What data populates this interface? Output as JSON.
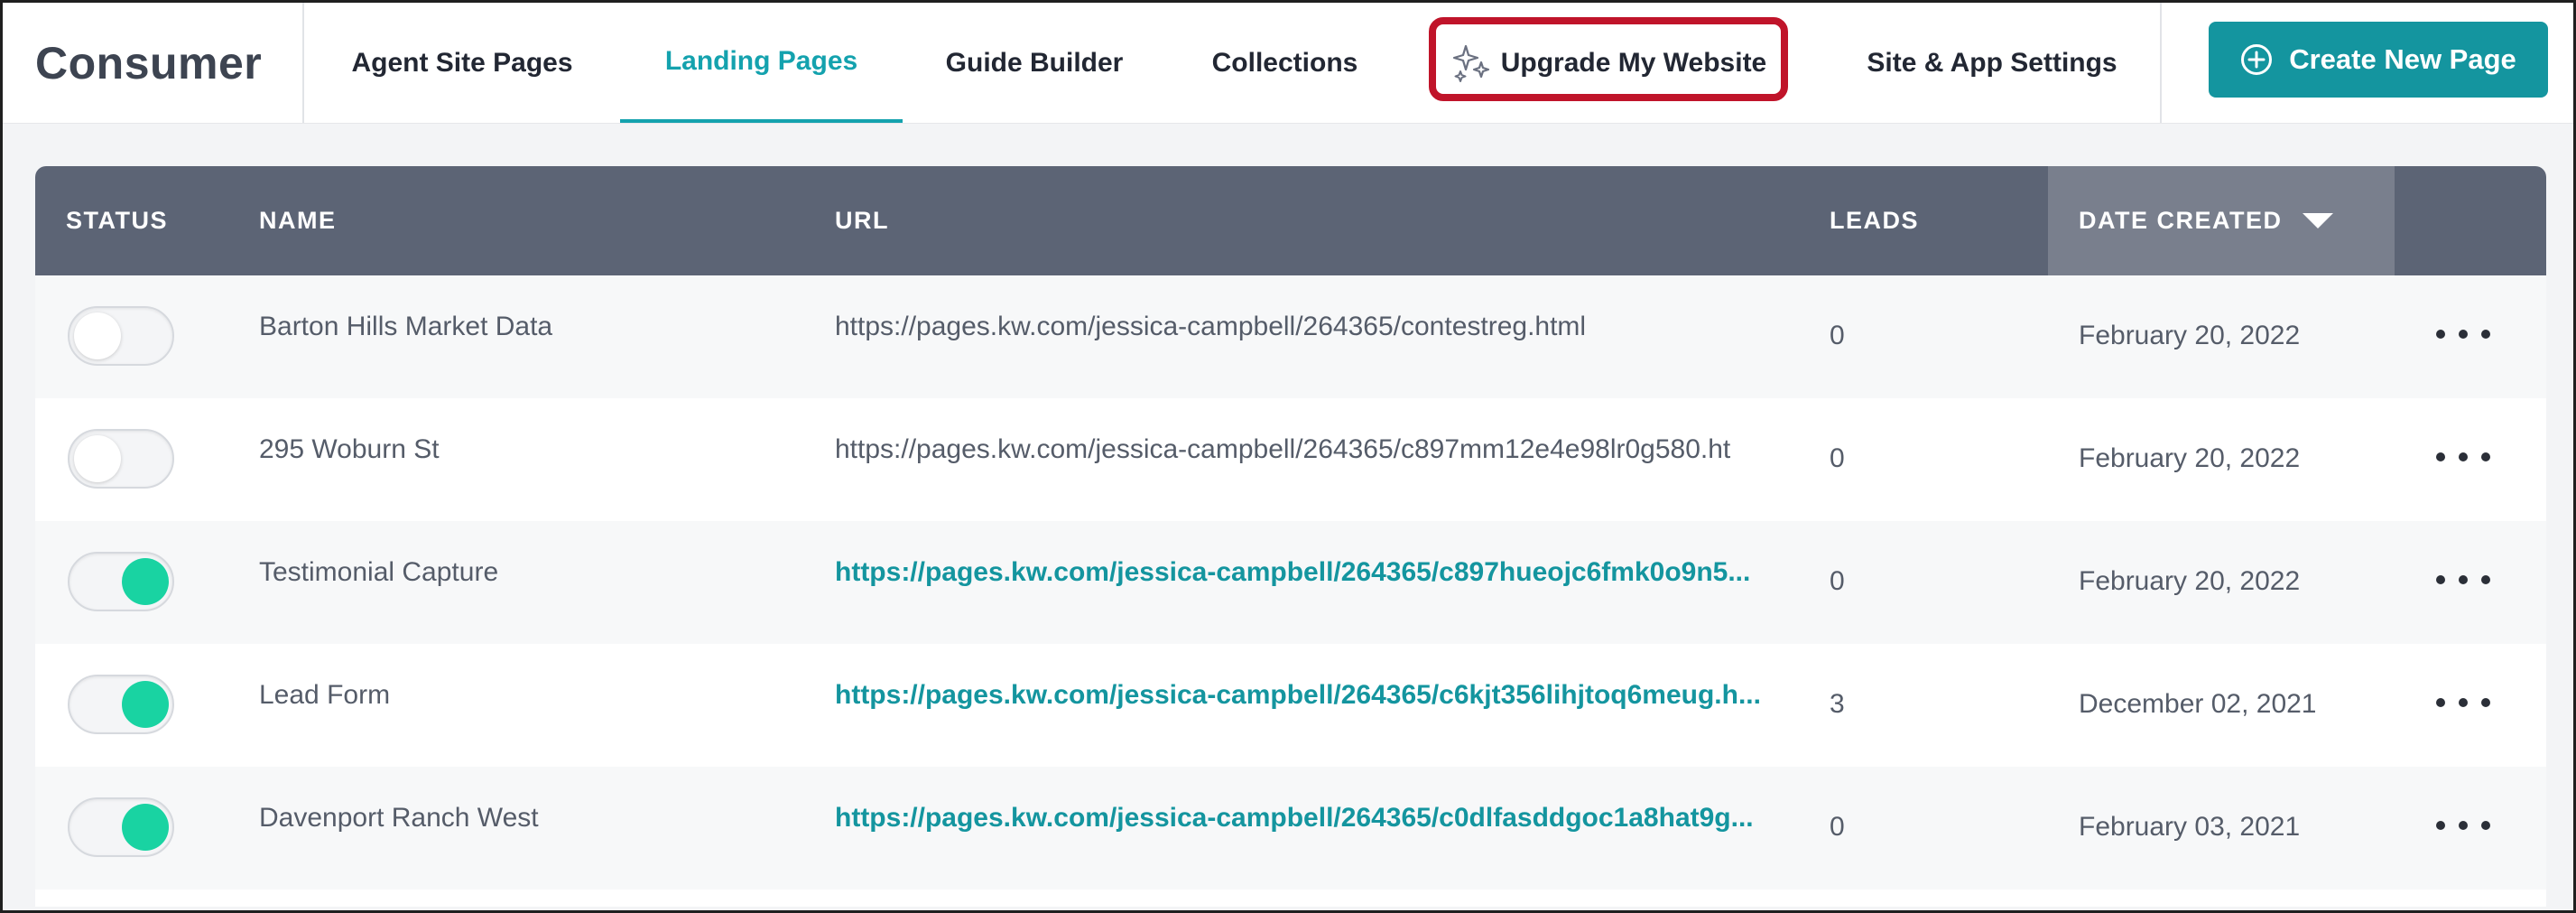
{
  "brand": "Consumer",
  "tabs": [
    {
      "label": "Agent Site Pages"
    },
    {
      "label": "Landing Pages"
    },
    {
      "label": "Guide Builder"
    },
    {
      "label": "Collections"
    },
    {
      "label": "Upgrade My Website",
      "icon": "sparkles-icon"
    },
    {
      "label": "Site & App Settings"
    }
  ],
  "active_tab": "Landing Pages",
  "create_button": {
    "label": "Create New Page",
    "icon": "plus-circle-icon"
  },
  "colors": {
    "accent": "#14959f",
    "header_bg": "#5c6475",
    "toggle_on": "#19d3a2",
    "highlight": "#c0142a"
  },
  "table": {
    "columns": {
      "status": "STATUS",
      "name": "NAME",
      "url": "URL",
      "leads": "LEADS",
      "date": "DATE CREATED"
    },
    "sort": {
      "column": "DATE CREATED",
      "direction": "descending"
    },
    "rows": [
      {
        "enabled": false,
        "name": "Barton Hills Market Data",
        "url": "https://pages.kw.com/jessica-campbell/264365/contestreg.html",
        "leads": "0",
        "date": "February 20, 2022"
      },
      {
        "enabled": false,
        "name": "295 Woburn St",
        "url": "https://pages.kw.com/jessica-campbell/264365/c897mm12e4e98lr0g580.ht",
        "leads": "0",
        "date": "February 20, 2022"
      },
      {
        "enabled": true,
        "name": "Testimonial Capture",
        "url": "https://pages.kw.com/jessica-campbell/264365/c897hueojc6fmk0o9n5...",
        "leads": "0",
        "date": "February 20, 2022"
      },
      {
        "enabled": true,
        "name": "Lead Form",
        "url": "https://pages.kw.com/jessica-campbell/264365/c6kjt356lihjtoq6meug.h...",
        "leads": "3",
        "date": "December 02, 2021"
      },
      {
        "enabled": true,
        "name": "Davenport Ranch West",
        "url": "https://pages.kw.com/jessica-campbell/264365/c0dlfasddgoc1a8hat9g...",
        "leads": "0",
        "date": "February 03, 2021"
      }
    ]
  }
}
